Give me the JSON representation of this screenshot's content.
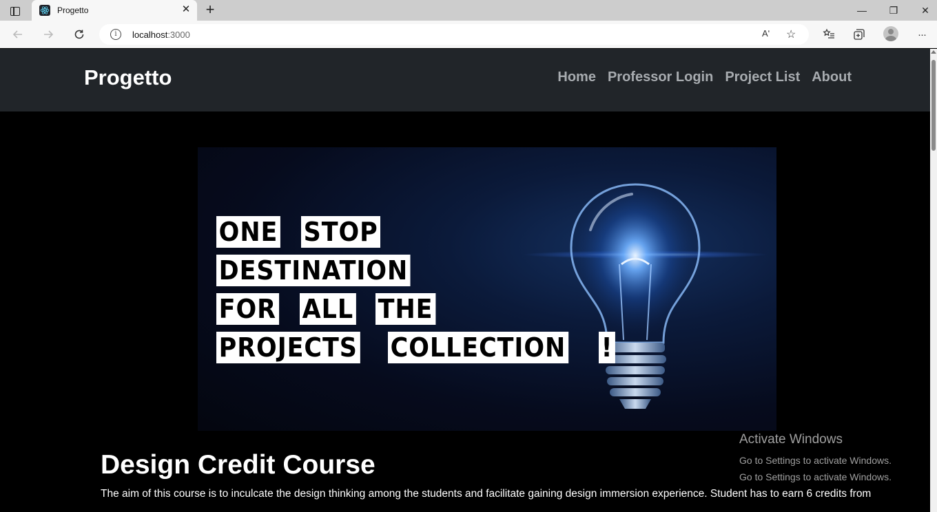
{
  "browser": {
    "tab_title": "Progetto",
    "tab_close": "✕",
    "new_tab": "+",
    "url_host": "localhost",
    "url_port": ":3000",
    "read_aloud": "Aʹ",
    "window_controls": {
      "minimize": "—",
      "restore": "❐",
      "close": "✕"
    },
    "more_menu": "···"
  },
  "navbar": {
    "brand": "Progetto",
    "links": [
      "Home",
      "Professor Login",
      "Project List",
      "About"
    ]
  },
  "hero": {
    "lines": [
      [
        "One",
        "Stop"
      ],
      [
        "Destination"
      ],
      [
        "For",
        "All",
        "The"
      ],
      [
        "Projects",
        "Collection",
        "!"
      ]
    ]
  },
  "course": {
    "title": "Design Credit Course",
    "description": "The aim of this course is to inculcate the design thinking among the students and facilitate gaining design immersion experience. Student has to earn 6 credits from"
  },
  "watermark": {
    "title": "Activate Windows",
    "subtitle": "Go to Settings to activate Windows.",
    "subtitle_repeat": "Go to Settings to activate Windows."
  },
  "icons": {
    "favicon": "react-icon",
    "back": "arrow-left-icon",
    "forward": "arrow-right-icon",
    "refresh": "refresh-icon",
    "info": "info-icon",
    "favorites": "star-list-icon",
    "collections": "collections-icon",
    "profile": "profile-icon"
  }
}
